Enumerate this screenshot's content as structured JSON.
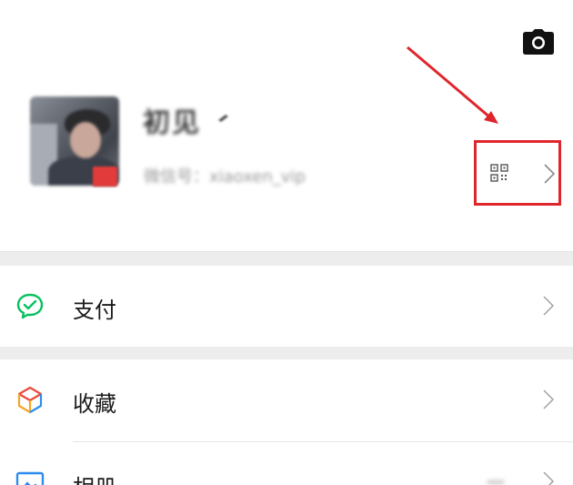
{
  "profile": {
    "nickname": "初见",
    "wechat_id": "微信号：xiaoxen_vip",
    "qr_label": "二维码"
  },
  "menu": [
    {
      "label": "支付",
      "icon": "wechat-pay-icon"
    },
    {
      "label": "收藏",
      "icon": "favorites-cube-icon"
    },
    {
      "label": "相册",
      "icon": "album-icon"
    }
  ],
  "colors": {
    "highlight": "#e0262d",
    "pay_green": "#07c160",
    "separator": "#ededed"
  }
}
